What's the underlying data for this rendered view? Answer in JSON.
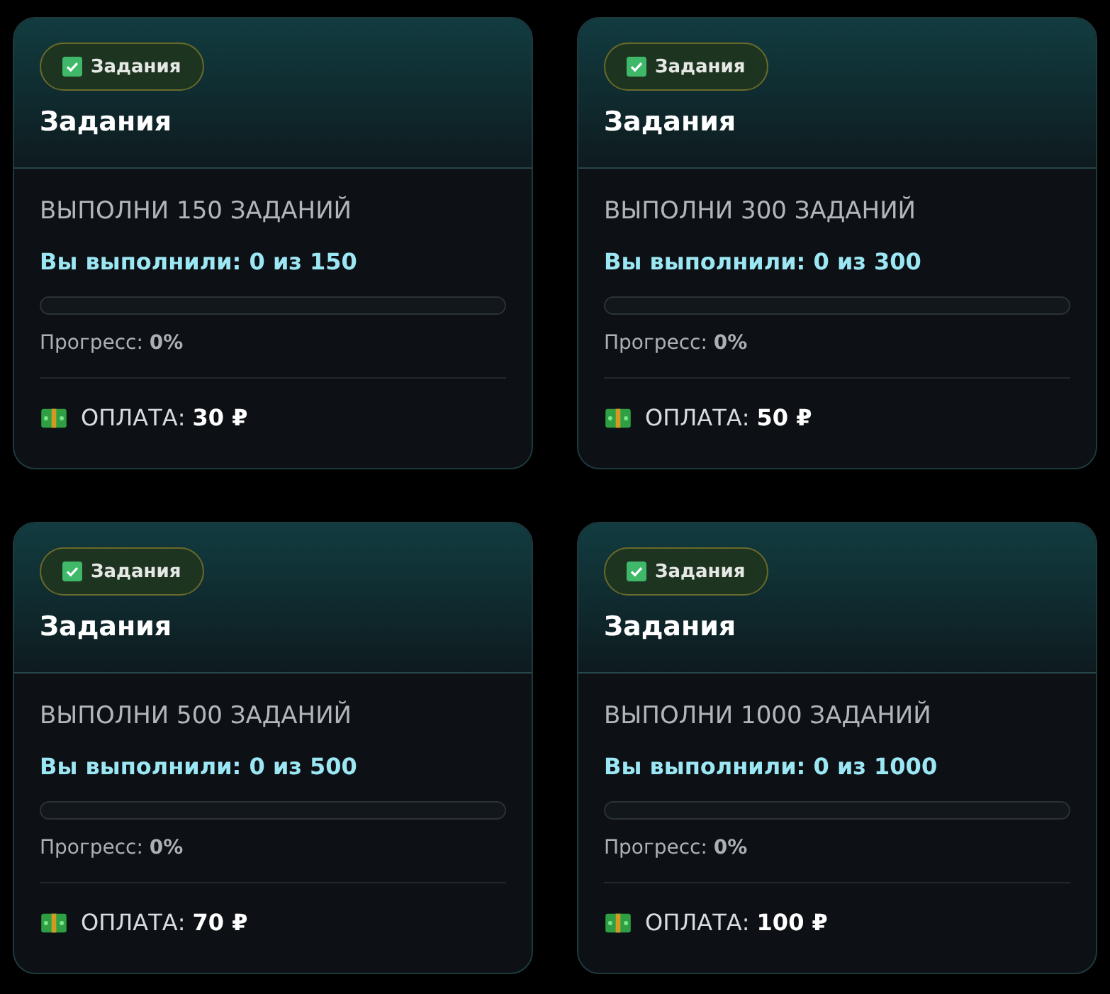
{
  "cards": [
    {
      "badge": "Задания",
      "title": "Задания",
      "task": "ВЫПОЛНИ 150 ЗАДАНИЙ",
      "done": "Вы выполнили: 0 из 150",
      "level": 0,
      "progress_label": "Прогресс:",
      "progress_value": "0%",
      "pay_label": "ОПЛАТА:",
      "pay_value": "30 ₽"
    },
    {
      "badge": "Задания",
      "title": "Задания",
      "task": "ВЫПОЛНИ 300 ЗАДАНИЙ",
      "done": "Вы выполнили: 0 из 300",
      "level": 0,
      "progress_label": "Прогресс:",
      "progress_value": "0%",
      "pay_label": "ОПЛАТА:",
      "pay_value": "50 ₽"
    },
    {
      "badge": "Задания",
      "title": "Задания",
      "task": "ВЫПОЛНИ 500 ЗАДАНИЙ",
      "done": "Вы выполнили: 0 из 500",
      "level": 0,
      "progress_label": "Прогресс:",
      "progress_value": "0%",
      "pay_label": "ОПЛАТА:",
      "pay_value": "70 ₽"
    },
    {
      "badge": "Задания",
      "title": "Задания",
      "task": "ВЫПОЛНИ 1000 ЗАДАНИЙ",
      "done": "Вы выполнили: 0 из 1000",
      "level": 0,
      "progress_label": "Прогресс:",
      "progress_value": "0%",
      "pay_label": "ОПЛАТА:",
      "pay_value": "100 ₽"
    }
  ]
}
